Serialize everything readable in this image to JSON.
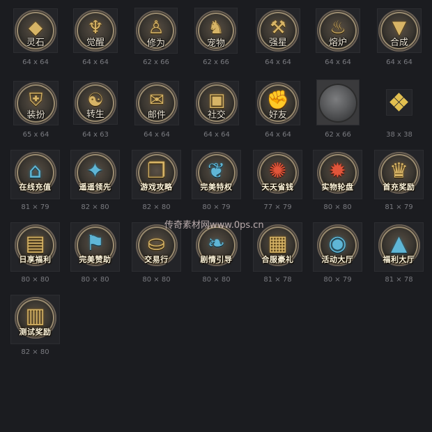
{
  "tiles": [
    {
      "label": "灵石",
      "dims": "64 x 64",
      "icon": "gold-crystal-icon"
    },
    {
      "label": "觉醒",
      "dims": "64 x 64",
      "icon": "golden-wings-icon"
    },
    {
      "label": "修为",
      "dims": "62 x 66",
      "icon": "monk-figure-icon"
    },
    {
      "label": "宠物",
      "dims": "62 x 66",
      "icon": "beast-head-icon"
    },
    {
      "label": "强星",
      "dims": "64 x 64",
      "icon": "anvil-hammer-icon"
    },
    {
      "label": "熔炉",
      "dims": "64 x 64",
      "icon": "furnace-icon"
    },
    {
      "label": "合成",
      "dims": "64 x 64",
      "icon": "gold-gem-icon"
    },
    {
      "label": "装扮",
      "dims": "65 x 64",
      "icon": "armor-icon"
    },
    {
      "label": "转生",
      "dims": "64 x 63",
      "icon": "yin-yang-icon"
    },
    {
      "label": "邮件",
      "dims": "64 x 64",
      "icon": "mail-icon"
    },
    {
      "label": "社交",
      "dims": "64 x 64",
      "icon": "treasure-chest-icon"
    },
    {
      "label": "好友",
      "dims": "64 x 64",
      "icon": "handshake-icon"
    },
    {
      "label": "",
      "dims": "62 x 66",
      "icon": "stone-disc-icon"
    },
    {
      "label": "",
      "dims": "38 x 38",
      "icon": "gold-diamonds-icon"
    },
    {
      "label": "在线充值",
      "dims": "81 × 79",
      "icon": "pagoda-icon"
    },
    {
      "label": "遥遥领先",
      "dims": "82 × 80",
      "icon": "jade-blade-icon"
    },
    {
      "label": "游戏攻略",
      "dims": "82 × 80",
      "icon": "scroll-book-icon"
    },
    {
      "label": "完美特权",
      "dims": "80 × 79",
      "icon": "blue-phoenix-icon"
    },
    {
      "label": "天天省钱",
      "dims": "77 × 79",
      "icon": "red-fan-icon"
    },
    {
      "label": "实物轮盘",
      "dims": "80 × 80",
      "icon": "roulette-wheel-icon"
    },
    {
      "label": "首充奖励",
      "dims": "81 × 79",
      "icon": "gift-chest-icon"
    },
    {
      "label": "日享福利",
      "dims": "80 × 80",
      "icon": "open-chest-icon"
    },
    {
      "label": "完美赞助",
      "dims": "80 × 80",
      "icon": "blue-banner-icon"
    },
    {
      "label": "交易行",
      "dims": "80 × 80",
      "icon": "gold-coins-icon"
    },
    {
      "label": "剧情引导",
      "dims": "80 × 80",
      "icon": "blue-dragon-icon"
    },
    {
      "label": "合服豪礼",
      "dims": "81 × 78",
      "icon": "gold-box-icon"
    },
    {
      "label": "活动大厅",
      "dims": "80 × 79",
      "icon": "crystal-orb-icon"
    },
    {
      "label": "福利大厅",
      "dims": "81 × 78",
      "icon": "blue-pyramid-icon"
    },
    {
      "label": "测试奖励",
      "dims": "82 × 80",
      "icon": "chest-icon"
    }
  ],
  "watermark": "传奇素材网www.0ps.cn"
}
